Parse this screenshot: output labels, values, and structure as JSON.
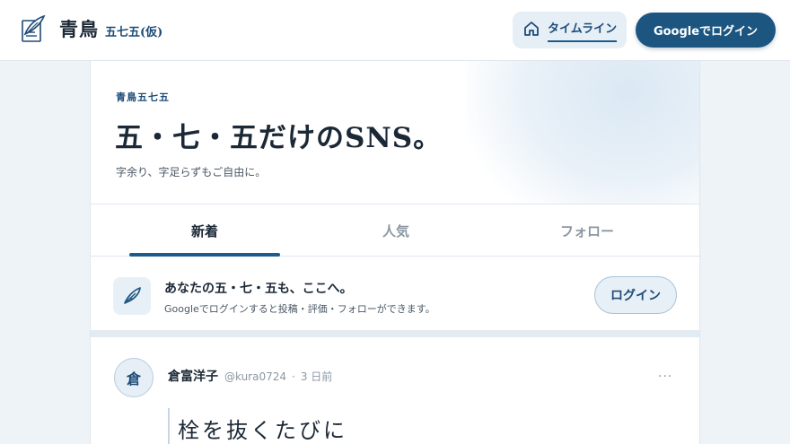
{
  "header": {
    "brand_title": "青鳥",
    "brand_subtitle": "五七五(仮)",
    "timeline_label": "タイムライン",
    "login_label": "Googleでログイン"
  },
  "hero": {
    "eyebrow": "青鳥五七五",
    "title": "五・七・五だけのSNS。",
    "subtitle": "字余り、字足らずもご自由に。"
  },
  "tabs": [
    {
      "label": "新着",
      "active": true
    },
    {
      "label": "人気",
      "active": false
    },
    {
      "label": "フォロー",
      "active": false
    }
  ],
  "prompt": {
    "title": "あなたの五・七・五も、ここへ。",
    "subtitle": "Googleでログインすると投稿・評価・フォローができます。",
    "login_label": "ログイン"
  },
  "post": {
    "avatar_char": "倉",
    "name": "倉富洋子",
    "handle": "@kura0724",
    "separator": "·",
    "time": "3 日前",
    "more": "···",
    "body": "栓を抜くたびに"
  },
  "colors": {
    "accent": "#1c5680",
    "background": "#eef3f8"
  },
  "icons": {
    "brand": "quill-document-icon",
    "timeline": "home-icon",
    "prompt": "feather-icon"
  }
}
